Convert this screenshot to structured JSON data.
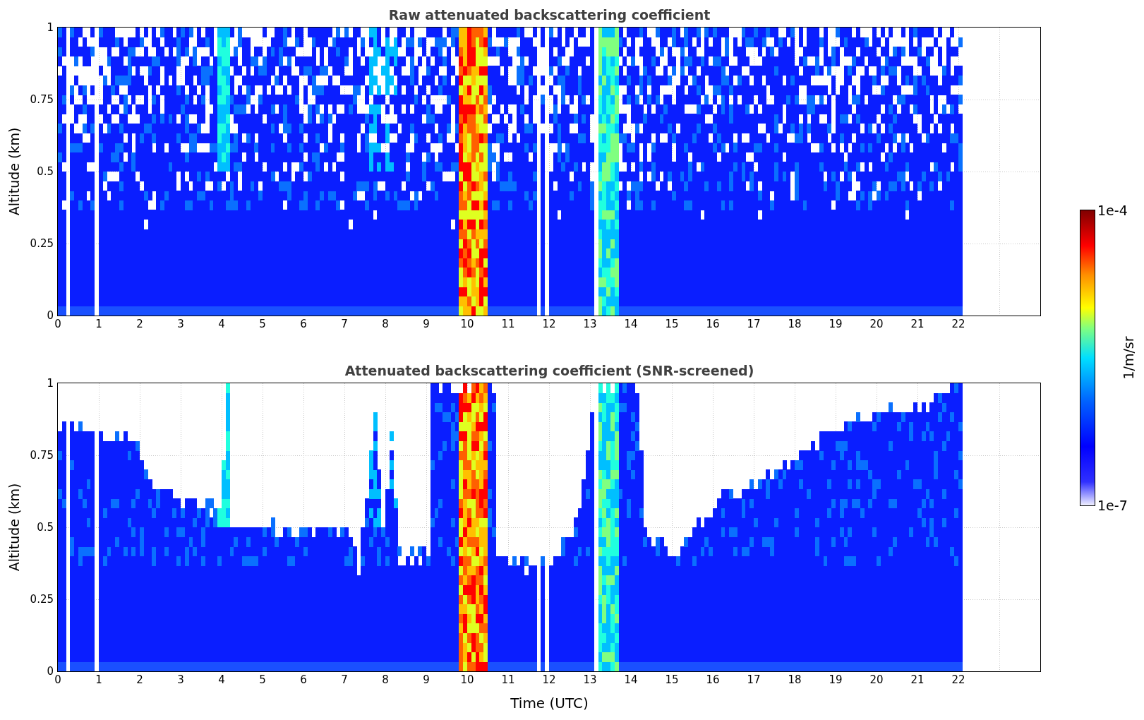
{
  "panels": [
    {
      "kind": "raw",
      "title": "Raw attenuated backscattering coefficient",
      "ylabel": "Altitude (km)",
      "yticks": [
        "1",
        "0.75",
        "0.5",
        "0.25",
        "0"
      ],
      "xticks": [
        "0",
        "1",
        "2",
        "3",
        "4",
        "5",
        "6",
        "7",
        "8",
        "9",
        "10",
        "11",
        "12",
        "13",
        "14",
        "15",
        "16",
        "17",
        "18",
        "19",
        "20",
        "21",
        "22"
      ]
    },
    {
      "kind": "screened",
      "title": "Attenuated backscattering coefficient (SNR-screened)",
      "ylabel": "Altitude (km)",
      "yticks": [
        "1",
        "0.75",
        "0.5",
        "0.25",
        "0"
      ],
      "xticks": [
        "0",
        "1",
        "2",
        "3",
        "4",
        "5",
        "6",
        "7",
        "8",
        "9",
        "10",
        "11",
        "12",
        "13",
        "14",
        "15",
        "16",
        "17",
        "18",
        "19",
        "20",
        "21",
        "22"
      ]
    }
  ],
  "xlabel": "Time (UTC)",
  "colorbar": {
    "label": "1/m/sr",
    "max_label": "1e-4",
    "min_label": "1e-7"
  }
}
